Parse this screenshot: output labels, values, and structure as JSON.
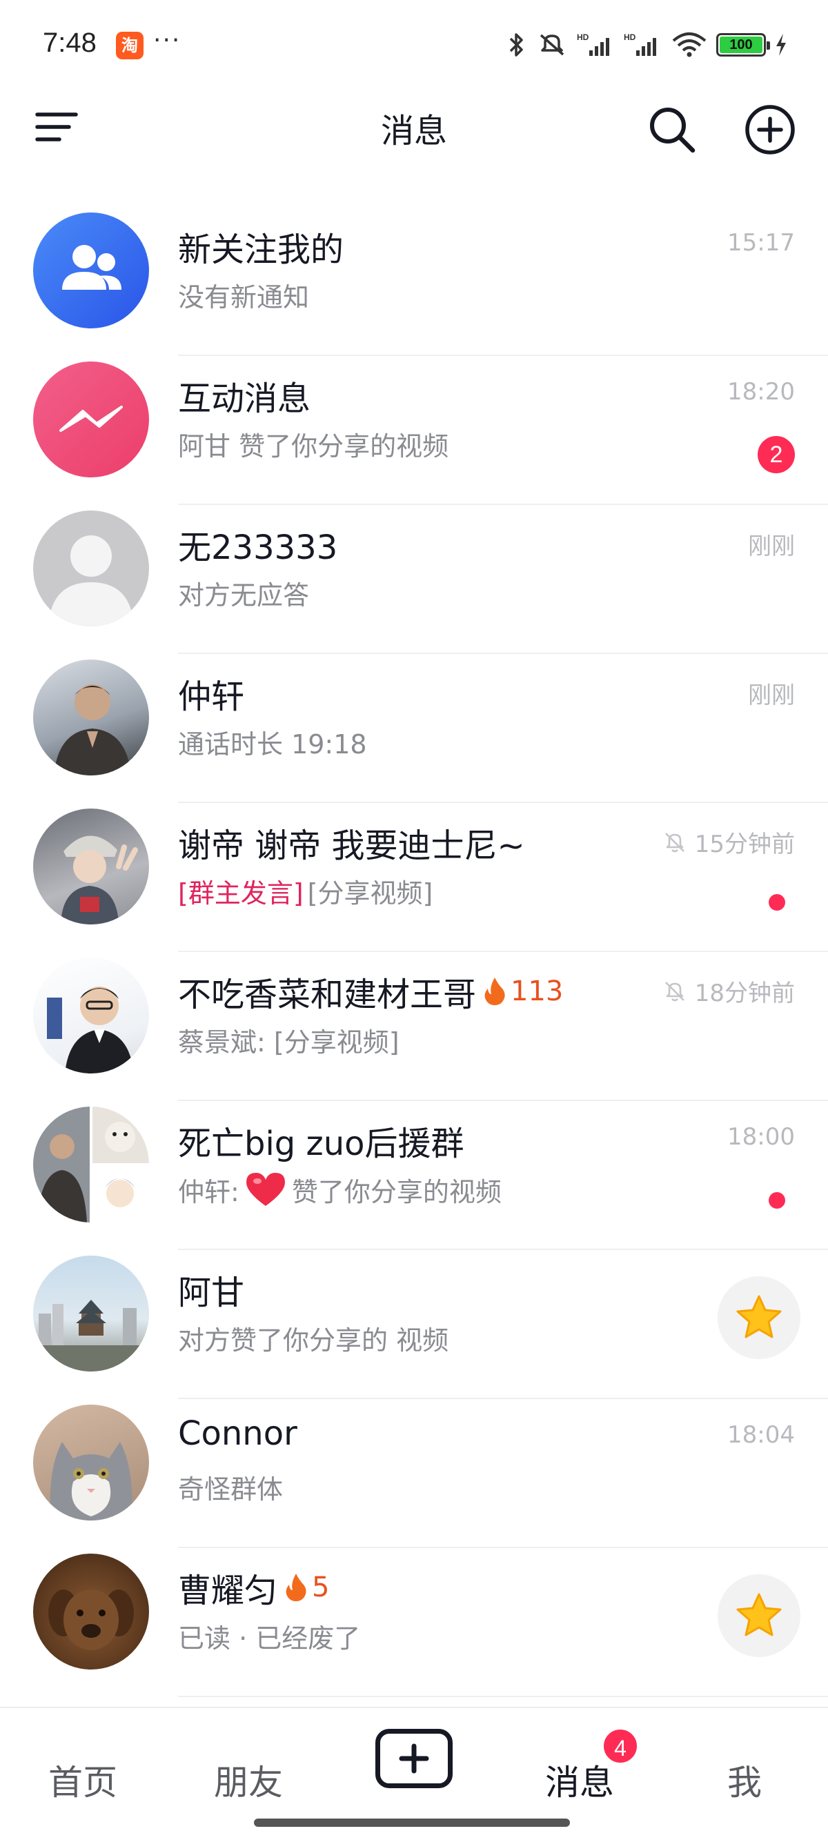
{
  "status_bar": {
    "time": "7:48",
    "app_icon_label": "淘",
    "more": "···",
    "battery": "100",
    "icons": [
      "bluetooth-icon",
      "mute-icon",
      "signal-hd-icon",
      "signal-hd-icon",
      "wifi-icon",
      "battery-icon",
      "charging-icon"
    ]
  },
  "header": {
    "title": "消息",
    "icons": [
      "menu-icon",
      "search-icon",
      "add-circle-icon"
    ]
  },
  "conversations": [
    {
      "name": "新关注我的",
      "subtitle": "没有新通知",
      "time": "15:17",
      "avatar": "followers-icon"
    },
    {
      "name": "互动消息",
      "subtitle": "阿甘 赞了你分享的视频",
      "time": "18:20",
      "badge": "2",
      "avatar": "interaction-icon"
    },
    {
      "name": "无233333",
      "subtitle": "对方无应答",
      "time": "刚刚",
      "avatar": "default-avatar"
    },
    {
      "name": "仲轩",
      "subtitle": "通话时长 19:18",
      "time": "刚刚",
      "avatar": "photo-avatar"
    },
    {
      "name": "谢帝 谢帝 我要迪士尼~",
      "subtitle_tag": "[群主发言]",
      "subtitle": "[分享视频]",
      "time": "15分钟前",
      "muted": true,
      "unread_dot": true,
      "avatar": "photo-avatar"
    },
    {
      "name": "不吃香菜和建材王哥",
      "fire_count": "113",
      "subtitle": "蔡景斌: [分享视频]",
      "time": "18分钟前",
      "muted": true,
      "avatar": "photo-avatar"
    },
    {
      "name": "死亡big zuo后援群",
      "subtitle_prefix": "仲轩:",
      "subtitle": "赞了你分享的视频",
      "time": "18:00",
      "unread_dot": true,
      "avatar": "group-avatar"
    },
    {
      "name": "阿甘",
      "subtitle": "对方赞了你分享的 视频",
      "star": true,
      "avatar": "photo-avatar"
    },
    {
      "name": "Connor",
      "subtitle": "奇怪群体",
      "time": "18:04",
      "avatar": "cat-avatar"
    },
    {
      "name": "曹耀匀",
      "fire_count": "5",
      "subtitle": "已读 · 已经废了",
      "star": true,
      "avatar": "dog-avatar"
    }
  ],
  "bottom_nav": {
    "home": "首页",
    "friends": "朋友",
    "messages": "消息",
    "messages_badge": "4",
    "me": "我"
  },
  "colors": {
    "accent": "#fe2c55",
    "fire": "#e8511e",
    "blue_avatar": "#3a6cf4",
    "pink_avatar": "#f04e7a"
  }
}
